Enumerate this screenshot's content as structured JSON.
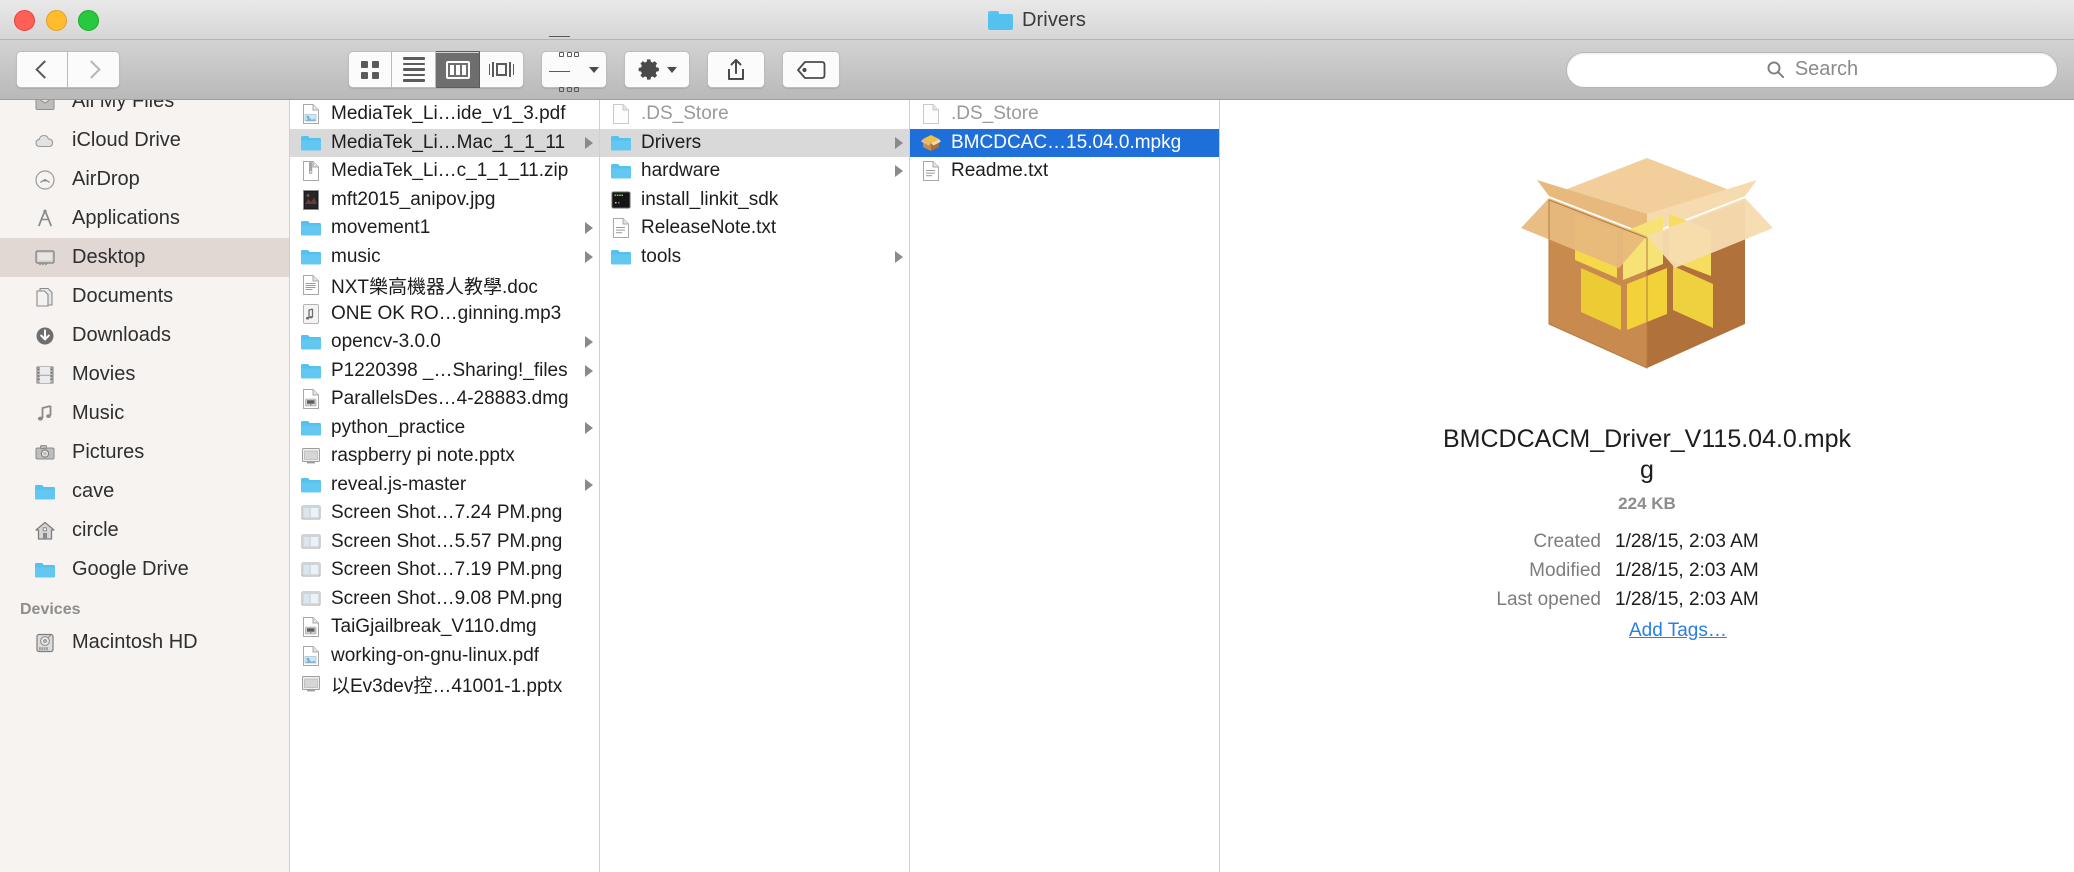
{
  "window": {
    "title": "Drivers",
    "title_icon": "folder-icon",
    "traffic_lights": [
      {
        "name": "close-button",
        "color": "#fe5f57"
      },
      {
        "name": "minimize-button",
        "color": "#febc2e"
      },
      {
        "name": "zoom-button",
        "color": "#28c840"
      }
    ]
  },
  "toolbar": {
    "back_label": "Back",
    "forward_label": "Forward",
    "views": [
      {
        "name": "icon-view",
        "icon": "grid-icon",
        "active": false
      },
      {
        "name": "list-view",
        "icon": "list-icon",
        "active": false
      },
      {
        "name": "column-view",
        "icon": "columns-icon",
        "active": true
      },
      {
        "name": "coverflow-view",
        "icon": "coverflow-icon",
        "active": false
      }
    ],
    "arrange_label": "Arrange",
    "action_label": "Action",
    "share_label": "Share",
    "tag_label": "Edit Tags"
  },
  "search": {
    "placeholder": "Search",
    "value": "",
    "icon": "search-icon"
  },
  "sidebar": {
    "sections": [
      {
        "header": "",
        "items": [
          {
            "label": "All My Files",
            "icon": "all-my-files-icon",
            "selected": false,
            "clipped": true
          },
          {
            "label": "iCloud Drive",
            "icon": "icloud-icon",
            "selected": false
          },
          {
            "label": "AirDrop",
            "icon": "airdrop-icon",
            "selected": false
          },
          {
            "label": "Applications",
            "icon": "applications-icon",
            "selected": false
          },
          {
            "label": "Desktop",
            "icon": "desktop-icon",
            "selected": true
          },
          {
            "label": "Documents",
            "icon": "documents-icon",
            "selected": false
          },
          {
            "label": "Downloads",
            "icon": "downloads-icon",
            "selected": false
          },
          {
            "label": "Movies",
            "icon": "movies-icon",
            "selected": false
          },
          {
            "label": "Music",
            "icon": "music-icon",
            "selected": false
          },
          {
            "label": "Pictures",
            "icon": "pictures-icon",
            "selected": false
          },
          {
            "label": "cave",
            "icon": "folder-icon",
            "selected": false
          },
          {
            "label": "circle",
            "icon": "home-icon",
            "selected": false
          },
          {
            "label": "Google Drive",
            "icon": "folder-icon",
            "selected": false
          }
        ]
      },
      {
        "header": "Devices",
        "items": [
          {
            "label": "Macintosh HD",
            "icon": "harddisk-icon",
            "selected": false
          }
        ]
      }
    ]
  },
  "columns": [
    {
      "name": "column-1",
      "items": [
        {
          "label": "MediaTek_Li…ide_v1_3.pdf",
          "icon": "pdf-icon",
          "state": "none",
          "disclosure": false
        },
        {
          "label": "MediaTek_Li…Mac_1_1_11",
          "icon": "folder-icon",
          "state": "gray",
          "disclosure": true
        },
        {
          "label": "MediaTek_Li…c_1_1_11.zip",
          "icon": "zip-icon",
          "state": "none",
          "disclosure": false
        },
        {
          "label": "mft2015_anipov.jpg",
          "icon": "image-icon",
          "state": "none",
          "disclosure": false
        },
        {
          "label": "movement1",
          "icon": "folder-icon",
          "state": "none",
          "disclosure": true
        },
        {
          "label": "music",
          "icon": "folder-icon",
          "state": "none",
          "disclosure": true
        },
        {
          "label": "NXT樂高機器人教學.doc",
          "icon": "doc-icon",
          "state": "none",
          "disclosure": false
        },
        {
          "label": "ONE OK RO…ginning.mp3",
          "icon": "audio-icon",
          "state": "none",
          "disclosure": false
        },
        {
          "label": "opencv-3.0.0",
          "icon": "folder-icon",
          "state": "none",
          "disclosure": true
        },
        {
          "label": "P1220398 _…Sharing!_files",
          "icon": "folder-icon",
          "state": "none",
          "disclosure": true
        },
        {
          "label": "ParallelsDes…4-28883.dmg",
          "icon": "dmg-icon",
          "state": "none",
          "disclosure": false
        },
        {
          "label": "python_practice",
          "icon": "folder-icon",
          "state": "none",
          "disclosure": true
        },
        {
          "label": "raspberry pi note.pptx",
          "icon": "pptx-icon",
          "state": "none",
          "disclosure": false
        },
        {
          "label": "reveal.js-master",
          "icon": "folder-icon",
          "state": "none",
          "disclosure": true
        },
        {
          "label": "Screen Shot…7.24 PM.png",
          "icon": "screenshot-icon",
          "state": "none",
          "disclosure": false
        },
        {
          "label": "Screen Shot…5.57 PM.png",
          "icon": "screenshot-icon",
          "state": "none",
          "disclosure": false
        },
        {
          "label": "Screen Shot…7.19 PM.png",
          "icon": "screenshot-icon",
          "state": "none",
          "disclosure": false
        },
        {
          "label": "Screen Shot…9.08 PM.png",
          "icon": "screenshot-icon",
          "state": "none",
          "disclosure": false
        },
        {
          "label": "TaiGjailbreak_V110.dmg",
          "icon": "dmg-icon",
          "state": "none",
          "disclosure": false
        },
        {
          "label": "working-on-gnu-linux.pdf",
          "icon": "pdf-icon",
          "state": "none",
          "disclosure": false
        },
        {
          "label": "以Ev3dev控…41001-1.pptx",
          "icon": "pptx-icon",
          "state": "none",
          "disclosure": false
        }
      ]
    },
    {
      "name": "column-2",
      "items": [
        {
          "label": ".DS_Store",
          "icon": "blank-doc-icon",
          "state": "none",
          "disclosure": false,
          "dim": true
        },
        {
          "label": "Drivers",
          "icon": "folder-icon",
          "state": "gray",
          "disclosure": true
        },
        {
          "label": "hardware",
          "icon": "folder-icon",
          "state": "none",
          "disclosure": true
        },
        {
          "label": "install_linkit_sdk",
          "icon": "terminal-icon",
          "state": "none",
          "disclosure": false
        },
        {
          "label": "ReleaseNote.txt",
          "icon": "text-icon",
          "state": "none",
          "disclosure": false
        },
        {
          "label": "tools",
          "icon": "folder-icon",
          "state": "none",
          "disclosure": true
        }
      ]
    },
    {
      "name": "column-3",
      "items": [
        {
          "label": ".DS_Store",
          "icon": "blank-doc-icon",
          "state": "none",
          "disclosure": false,
          "dim": true
        },
        {
          "label": "BMCDCAC…15.04.0.mpkg",
          "icon": "package-icon",
          "state": "blue",
          "disclosure": false
        },
        {
          "label": "Readme.txt",
          "icon": "text-icon",
          "state": "none",
          "disclosure": false
        }
      ]
    }
  ],
  "preview": {
    "icon": "package-box-icon",
    "filename": "BMCDCACM_Driver_V115.04.0.mpkg",
    "size": "224 KB",
    "metadata": [
      {
        "key": "Created",
        "value": "1/28/15, 2:03 AM"
      },
      {
        "key": "Modified",
        "value": "1/28/15, 2:03 AM"
      },
      {
        "key": "Last opened",
        "value": "1/28/15, 2:03 AM"
      }
    ],
    "add_tags_label": "Add Tags…"
  },
  "colors": {
    "selection_blue": "#1e6fd9",
    "selection_gray": "#d9d9d9",
    "folder_blue": "#55c1ef",
    "sidebar_selected": "#e1d7d3",
    "link_blue": "#2a7fe0"
  }
}
